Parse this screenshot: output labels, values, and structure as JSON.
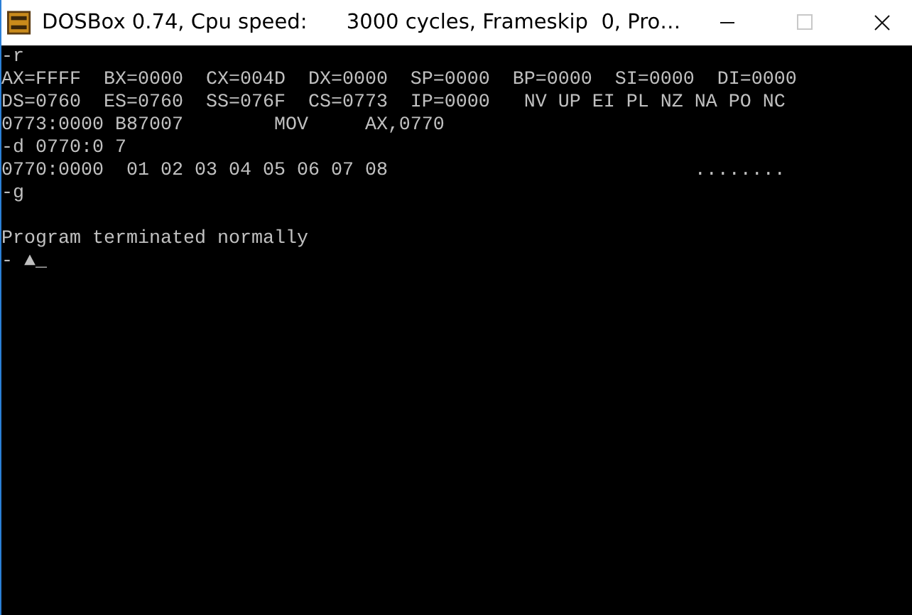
{
  "window": {
    "title": "DOSBox 0.74, Cpu speed:      3000 cycles, Frameskip  0, Pro…",
    "controls": [
      {
        "kind": "minimize",
        "disabled": false
      },
      {
        "kind": "maximize",
        "disabled": true
      },
      {
        "kind": "close",
        "disabled": false
      }
    ]
  },
  "console": {
    "lines": [
      {
        "kind": "text",
        "text": "-r"
      },
      {
        "kind": "text",
        "text": "AX=FFFF  BX=0000  CX=004D  DX=0000  SP=0000  BP=0000  SI=0000  DI=0000"
      },
      {
        "kind": "text",
        "text": "DS=0760  ES=0760  SS=076F  CS=0773  IP=0000   NV UP EI PL NZ NA PO NC"
      },
      {
        "kind": "text",
        "text": "0773:0000 B87007        MOV     AX,0770"
      },
      {
        "kind": "text",
        "text": "-d 0770:0 7"
      },
      {
        "kind": "text",
        "text": "0770:0000  01 02 03 04 05 06 07 08                           ........"
      },
      {
        "kind": "text",
        "text": "-g"
      },
      {
        "kind": "blank"
      },
      {
        "kind": "text",
        "text": "Program terminated normally"
      },
      {
        "kind": "text",
        "text": "- ▲_"
      }
    ]
  }
}
